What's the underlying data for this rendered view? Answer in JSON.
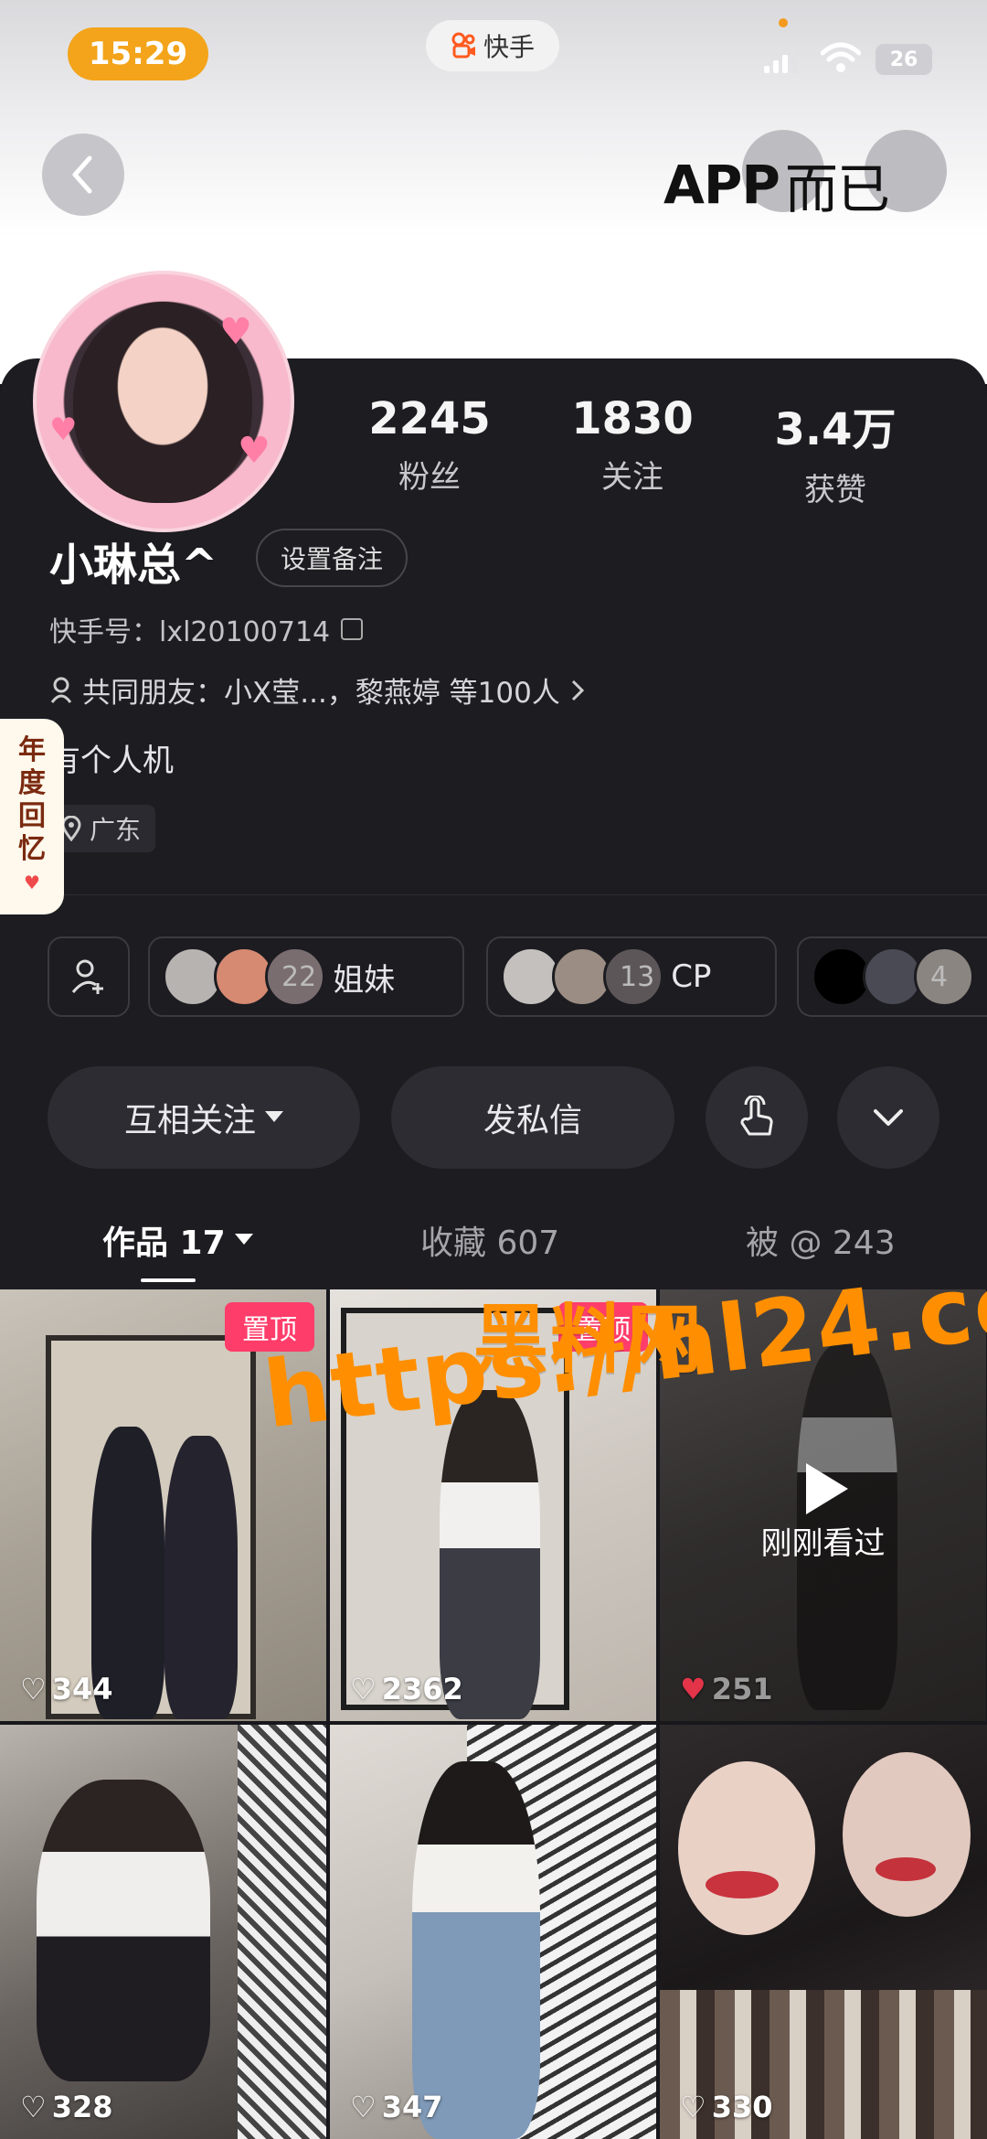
{
  "status_bar": {
    "time": "15:29",
    "app_name": "快手",
    "battery": "26"
  },
  "header": {
    "watermark_logo_en": "APP",
    "watermark_logo_zh": "而已"
  },
  "profile": {
    "name": "小琳总^",
    "remark_button": "设置备注",
    "ks_id": "快手号：lxl20100714",
    "mutual_friends": "共同朋友：小X莹...，黎燕婷 等100人",
    "bio": "有个人机",
    "location": "广东",
    "annual_review": [
      "年",
      "度",
      "回",
      "忆"
    ],
    "stats": [
      {
        "value": "2245",
        "label": "粉丝"
      },
      {
        "value": "1830",
        "label": "关注"
      },
      {
        "value": "3.4万",
        "label": "获赞"
      }
    ]
  },
  "groups": [
    {
      "count": "22",
      "name": "姐妹"
    },
    {
      "count": "13",
      "name": "CP"
    },
    {
      "count": "4",
      "name": ""
    }
  ],
  "actions": {
    "follow": "互相关注",
    "message": "发私信"
  },
  "tabs": [
    {
      "label": "作品 17",
      "active": true
    },
    {
      "label": "收藏 607",
      "active": false
    },
    {
      "label": "被 @ 243",
      "active": false
    }
  ],
  "videos": [
    {
      "likes": "344",
      "badge": "置顶"
    },
    {
      "likes": "2362",
      "badge": "置顶"
    },
    {
      "likes": "251",
      "seen": "刚刚看过"
    },
    {
      "likes": "328"
    },
    {
      "likes": "347"
    },
    {
      "likes": "330"
    }
  ],
  "overlay_watermark": {
    "line1": "黑料网",
    "line2": "https://hl24.co"
  }
}
